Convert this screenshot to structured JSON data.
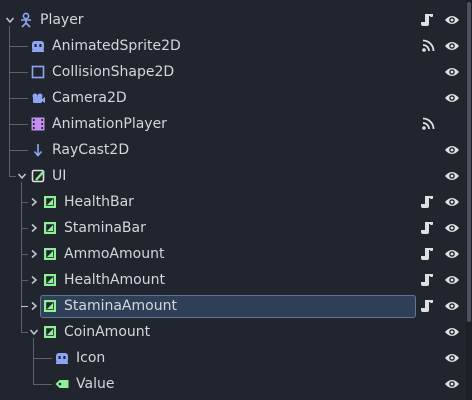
{
  "tree": {
    "nodes": [
      {
        "label": "Player",
        "type": "character",
        "depth": 0,
        "expand": "expanded",
        "script": true,
        "signal": false,
        "visible": true
      },
      {
        "label": "AnimatedSprite2D",
        "type": "animated-sprite",
        "depth": 1,
        "expand": "none",
        "script": false,
        "signal": true,
        "visible": true
      },
      {
        "label": "CollisionShape2D",
        "type": "collision-shape",
        "depth": 1,
        "expand": "none",
        "script": false,
        "signal": false,
        "visible": true
      },
      {
        "label": "Camera2D",
        "type": "camera",
        "depth": 1,
        "expand": "none",
        "script": false,
        "signal": false,
        "visible": true
      },
      {
        "label": "AnimationPlayer",
        "type": "animation-player",
        "depth": 1,
        "expand": "none",
        "script": false,
        "signal": true,
        "visible": false
      },
      {
        "label": "RayCast2D",
        "type": "raycast",
        "depth": 1,
        "expand": "none",
        "script": false,
        "signal": false,
        "visible": true
      },
      {
        "label": "UI",
        "type": "control",
        "depth": 1,
        "expand": "expanded",
        "script": false,
        "signal": false,
        "visible": true
      },
      {
        "label": "HealthBar",
        "type": "nine-patch",
        "depth": 2,
        "expand": "collapsed",
        "script": true,
        "signal": false,
        "visible": true
      },
      {
        "label": "StaminaBar",
        "type": "nine-patch",
        "depth": 2,
        "expand": "collapsed",
        "script": true,
        "signal": false,
        "visible": true
      },
      {
        "label": "AmmoAmount",
        "type": "nine-patch",
        "depth": 2,
        "expand": "collapsed",
        "script": true,
        "signal": false,
        "visible": true
      },
      {
        "label": "HealthAmount",
        "type": "nine-patch",
        "depth": 2,
        "expand": "collapsed",
        "script": true,
        "signal": false,
        "visible": true
      },
      {
        "label": "StaminaAmount",
        "type": "nine-patch",
        "depth": 2,
        "expand": "collapsed",
        "script": true,
        "signal": false,
        "visible": true,
        "selected": true
      },
      {
        "label": "CoinAmount",
        "type": "nine-patch",
        "depth": 2,
        "expand": "expanded",
        "script": false,
        "signal": false,
        "visible": true
      },
      {
        "label": "Icon",
        "type": "texture-rect",
        "depth": 3,
        "expand": "none",
        "script": false,
        "signal": false,
        "visible": true
      },
      {
        "label": "Value",
        "type": "label",
        "depth": 3,
        "expand": "none",
        "script": false,
        "signal": false,
        "visible": true
      }
    ]
  },
  "colors": {
    "background": "#21262e",
    "text": "#d3d6dc",
    "node_2d_blue": "#8da5f3",
    "control_green": "#8eef97",
    "animation_purple": "#c38ef1",
    "selection_bg": "#2f3f58",
    "selection_border": "#5f7594",
    "guide_line": "#5a6270",
    "icon_light": "#e0e0e0"
  },
  "icons": {
    "script": "script-icon",
    "signal": "signal-icon",
    "visible": "eye-icon",
    "hidden": "eye-hidden-icon"
  }
}
